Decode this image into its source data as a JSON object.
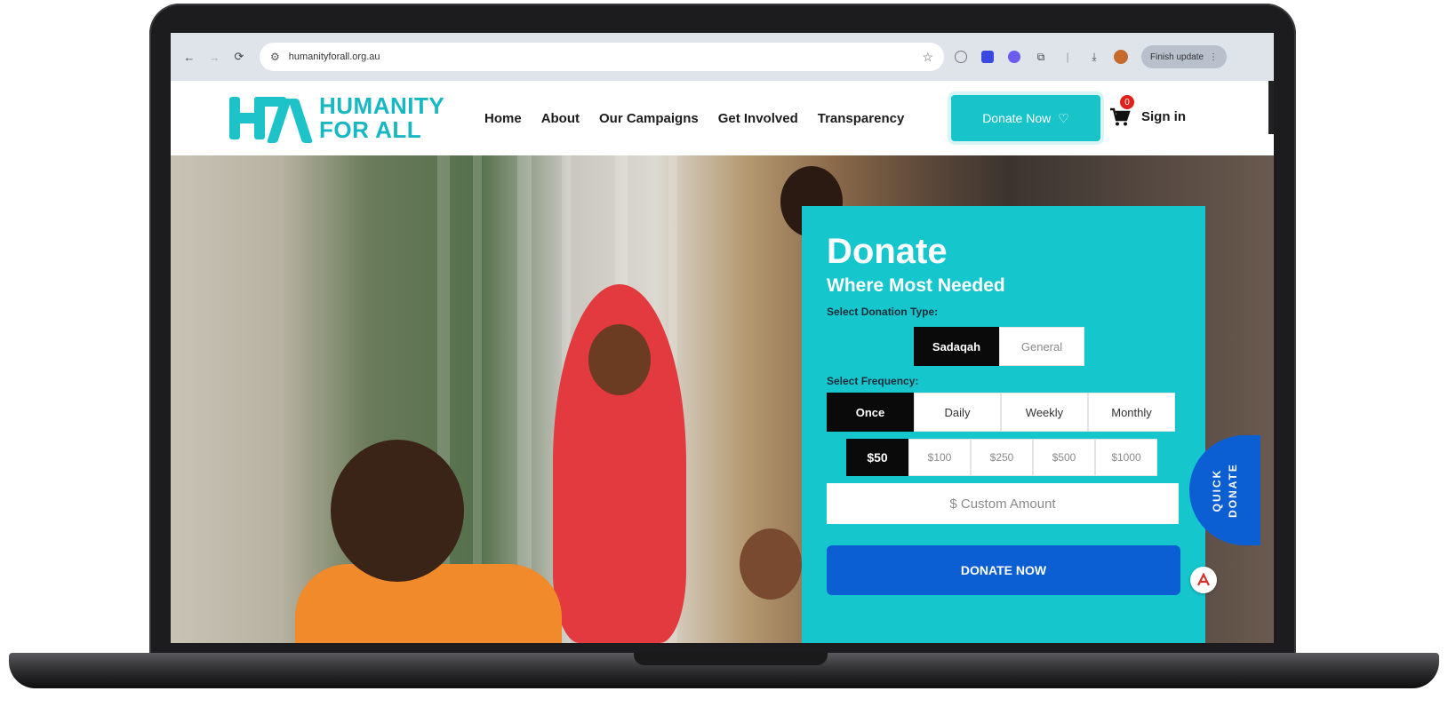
{
  "browser": {
    "url": "humanityforall.org.au",
    "update_label": "Finish update",
    "icons": [
      "back-arrow-icon",
      "forward-arrow-icon",
      "reload-icon",
      "site-settings-icon",
      "bookmark-star-icon",
      "extensions-icon",
      "download-icon",
      "profile-avatar-icon",
      "menu-kebab-icon"
    ]
  },
  "brand": {
    "line1": "HUMANITY",
    "line2": "FOR ALL",
    "accent_color": "#18c3c9"
  },
  "nav": {
    "items": [
      "Home",
      "About",
      "Our Campaigns",
      "Get Involved",
      "Transparency"
    ]
  },
  "header": {
    "donate_label": "Donate Now",
    "cart_count": "0",
    "sign_in": "Sign in"
  },
  "donate_panel": {
    "title": "Donate",
    "subtitle": "Where Most Needed",
    "type_label": "Select Donation Type:",
    "types": [
      "Sadaqah",
      "General"
    ],
    "selected_type": "Sadaqah",
    "frequency_label": "Select Frequency:",
    "frequencies": [
      "Once",
      "Daily",
      "Weekly",
      "Monthly"
    ],
    "selected_frequency": "Once",
    "amounts": [
      "$50",
      "$100",
      "$250",
      "$500",
      "$1000"
    ],
    "selected_amount": "$50",
    "custom_placeholder": "$ Custom Amount",
    "submit_label": "DONATE NOW",
    "panel_color": "#15c6cd",
    "button_color": "#0c5fd3"
  },
  "quick_donate": {
    "line1": "QUICK",
    "line2": "DONATE"
  }
}
